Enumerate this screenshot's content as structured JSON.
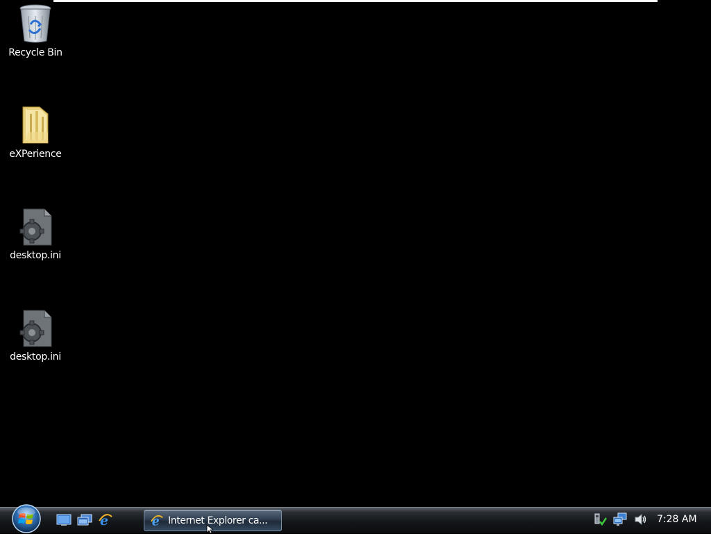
{
  "desktop": {
    "icons": [
      {
        "label": "Recycle Bin",
        "icon": "recycle-bin-icon"
      },
      {
        "label": "eXPerience",
        "icon": "folder-icon"
      },
      {
        "label": "desktop.ini",
        "icon": "settings-file-icon"
      },
      {
        "label": "desktop.ini",
        "icon": "settings-file-icon"
      }
    ]
  },
  "taskbar": {
    "start_icon": "windows-start-orb-icon",
    "quick_launch": [
      {
        "icon": "show-desktop-icon"
      },
      {
        "icon": "switch-windows-icon"
      },
      {
        "icon": "internet-explorer-icon"
      }
    ],
    "task_buttons": [
      {
        "label": "Internet Explorer ca...",
        "icon": "internet-explorer-icon"
      }
    ],
    "tray": {
      "icons": [
        "safely-remove-hardware-icon",
        "network-icon",
        "volume-icon"
      ],
      "clock": "7:28 AM"
    }
  }
}
